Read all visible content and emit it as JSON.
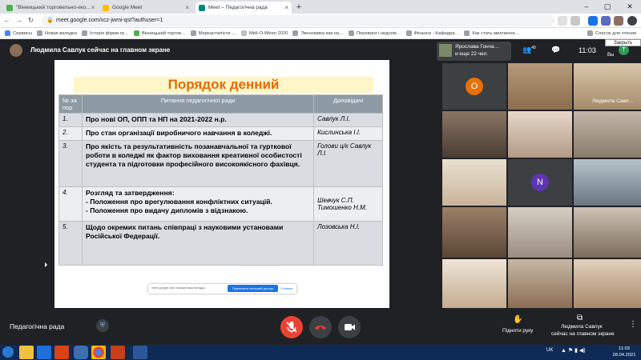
{
  "browser": {
    "tabs": [
      {
        "label": "\"Вінницький торговельно-еко…",
        "color": "#4caf50"
      },
      {
        "label": "Google Meet",
        "color": "#fbbc04"
      },
      {
        "label": "Meet – Педагогічна рада",
        "color": "#00897b"
      }
    ],
    "url": "meet.google.com/xcz-jwmi-qst?authuser=1",
    "bookmarks": [
      {
        "label": "Сервисы",
        "color": "#4285f4"
      },
      {
        "label": "Новая вкладка",
        "color": "#5f6368"
      },
      {
        "label": "Історія фірми гр…",
        "color": "#5f6368"
      },
      {
        "label": "Вінницький торгов…",
        "color": "#4caf50"
      },
      {
        "label": "Меркантилісти …",
        "color": "#5f6368"
      },
      {
        "label": "Meli-O-Ween 2020",
        "color": "#9e9e9e"
      },
      {
        "label": "Экономика как на…",
        "color": "#5f6368"
      },
      {
        "label": "Переваги і недолік…",
        "color": "#5f6368"
      },
      {
        "label": "Фінанси - Кафедра…",
        "color": "#5f6368"
      },
      {
        "label": "Как стать миллионе…",
        "color": "#5f6368"
      },
      {
        "label": "Список для чтения",
        "color": "#5f6368"
      }
    ],
    "close_label": "Закрыть"
  },
  "meet": {
    "presenting_text": "Людмила Савлук сейчас на главном экране",
    "participants_name": "Ярослава Гонча…",
    "participants_more": "и еще 22 чел.",
    "people_count": "40",
    "time": "11:03",
    "you_label": "Вы",
    "my_avatar_letter": "T",
    "meeting_title": "Педагогічна рада",
    "raise_hand_label": "Підняти руку",
    "presenter_label_1": "Людмила Савлук",
    "presenter_label_2": "сейчас на главном экране",
    "tile_label": "Людмила Савл…",
    "tile_letters": {
      "o": "O",
      "n": "N"
    },
    "share_notice": "meet.google.com показує ваш вкладку",
    "share_button": "Припинити спільний доступ",
    "share_cancel": "Сховати"
  },
  "slide": {
    "title": "Порядок денний",
    "headers": {
      "num": "№ за пор",
      "topic": "Питання педагогічної ради",
      "speaker": "Доповідачі"
    },
    "rows": [
      {
        "num": "1.",
        "topic": "Про нові ОП, ОПП та НП на 2021-2022 н.р.",
        "speaker": "Савлук Л.І."
      },
      {
        "num": "2.",
        "topic": "Про стан організації виробничого навчання в коледжі.",
        "speaker": "Кислинська І.І."
      },
      {
        "num": "3.",
        "topic": "Про якість та результативність позанавчальної та гурткової роботи в коледжі як фактор виховання креативної особистості студента та підготовки професійного високоякісного фахівця.",
        "speaker": "Голови ц/к Савлук Л.І."
      },
      {
        "num": "4.",
        "topic": "Розгляд та затвердження:\n- Положення про врегулювання конфліктних ситуацій.\n- Положення про видачу дипломів з відзнакою.",
        "speaker": "Шевчук С.П.\nТимошенко Н.М."
      },
      {
        "num": "5.",
        "topic": "Щодо окремих питань співпраці з науковими установами Російської Федерації.",
        "speaker": "Лозовська Н.І."
      }
    ]
  },
  "taskbar": {
    "lang": "UK",
    "time": "11:03",
    "date": "28.04.2021"
  }
}
